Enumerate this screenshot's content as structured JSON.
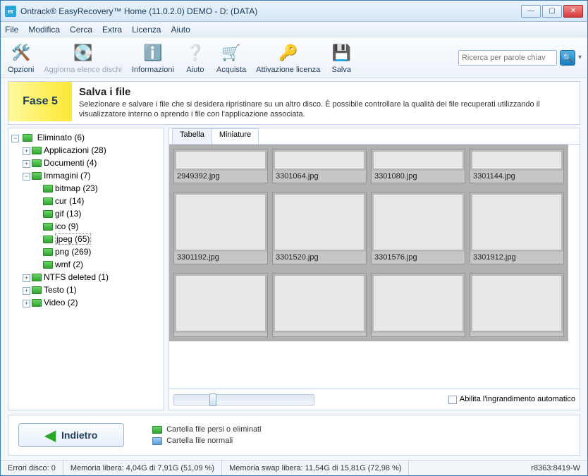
{
  "window": {
    "title": "Ontrack® EasyRecovery™ Home (11.0.2.0) DEMO - D: (DATA)",
    "app_icon_text": "er"
  },
  "menu": [
    "File",
    "Modifica",
    "Cerca",
    "Extra",
    "Licenza",
    "Aiuto"
  ],
  "toolbar": {
    "opzioni": "Opzioni",
    "aggiorna": "Aggiorna elenco dischi",
    "informazioni": "Informazioni",
    "aiuto": "Aiuto",
    "acquista": "Acquista",
    "attivazione": "Attivazione licenza",
    "salva": "Salva",
    "search_placeholder": "Ricerca per parole chiav"
  },
  "phase": {
    "badge": "Fase 5",
    "heading": "Salva i file",
    "desc": "Selezionare e salvare i file che si desidera ripristinare su un altro disco. È possibile controllare la qualità dei file recuperati utilizzando il visualizzatore interno o aprendo i file con l'applicazione associata."
  },
  "tree": {
    "root": "Eliminato (6)",
    "applicazioni": "Applicazioni (28)",
    "documenti": "Documenti (4)",
    "immagini": "Immagini (7)",
    "bitmap": "bitmap (23)",
    "cur": "cur (14)",
    "gif": "gif (13)",
    "ico": "ico (9)",
    "jpeg": "jpeg (65)",
    "png": "png (269)",
    "wmf": "wmf (2)",
    "ntfs": "NTFS deleted (1)",
    "testo": "Testo (1)",
    "video": "Video (2)"
  },
  "tabs": {
    "tabella": "Tabella",
    "miniature": "Miniature"
  },
  "thumbnails": {
    "row0": [
      "2949392.jpg",
      "3301064.jpg",
      "3301080.jpg",
      "3301144.jpg"
    ],
    "row1": [
      "3301192.jpg",
      "3301520.jpg",
      "3301576.jpg",
      "3301912.jpg"
    ],
    "row2_partial": [
      "",
      "",
      "",
      ""
    ]
  },
  "zoom": {
    "checkbox_label": "Abilita l'ingrandimento automatico"
  },
  "footer": {
    "back": "Indietro",
    "legend_lost": "Cartella file persi o eliminati",
    "legend_normal": "Cartella file normali"
  },
  "status": {
    "errori": "Errori disco: 0",
    "mem": "Memoria libera: 4,04G di 7,91G (51,09 %)",
    "swap": "Memoria swap libera: 11,54G di 15,81G (72,98 %)",
    "build": "r8363:8419-W"
  }
}
